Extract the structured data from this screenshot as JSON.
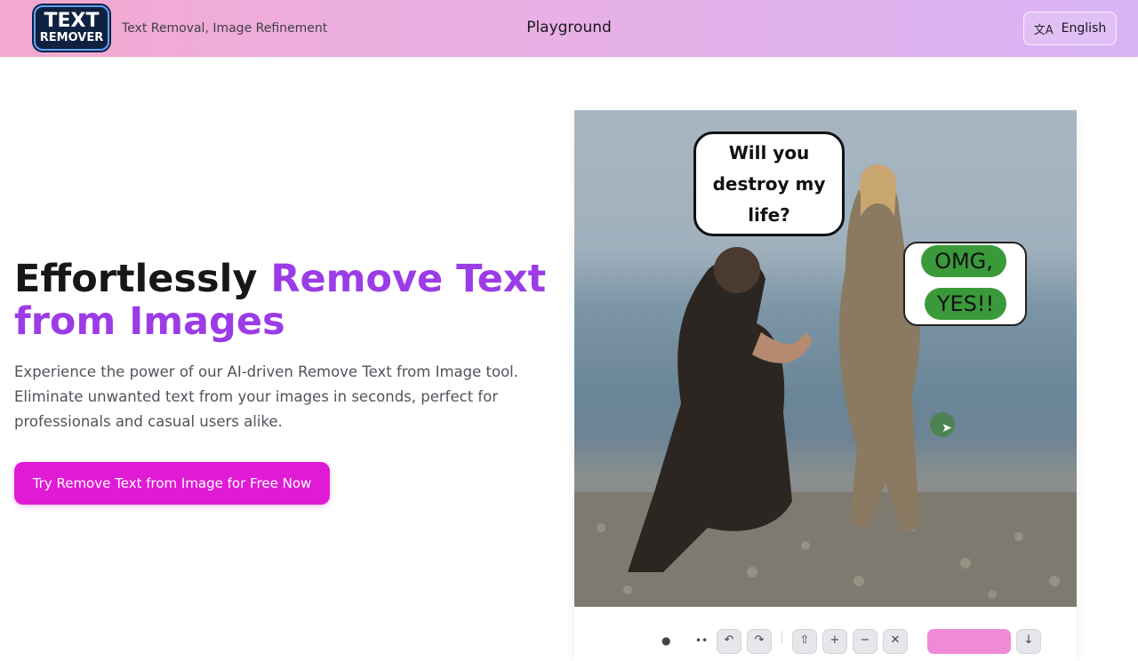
{
  "header": {
    "logo": {
      "line1": "TEXT",
      "line2": "REMOVER"
    },
    "tagline": "Text Removal, Image Refinement",
    "nav_playground": "Playground",
    "language_label": "English",
    "language_icon": "translate-icon"
  },
  "hero": {
    "title_part1": "Effortlessly ",
    "title_accent": "Remove Text from Images",
    "description": "Experience the power of our AI-driven Remove Text from Image tool. Eliminate unwanted text from your images in seconds, perfect for professionals and casual users alike.",
    "cta_label": "Try Remove Text from Image for Free Now"
  },
  "demo": {
    "bubble_left_text": "Will you destroy my life?",
    "bubble_right_line1": "OMG,",
    "bubble_right_line2": "YES!!"
  },
  "toolbar": {
    "icons": [
      "brush-icon",
      "brush-size-icon",
      "undo-icon",
      "redo-icon",
      "upload-icon",
      "zoom-in-icon",
      "zoom-out-icon",
      "delete-icon",
      "download-icon"
    ]
  },
  "colors": {
    "accent": "#9b3ce6",
    "cta": "#e11ad6",
    "mask": "#3a9a3a"
  }
}
